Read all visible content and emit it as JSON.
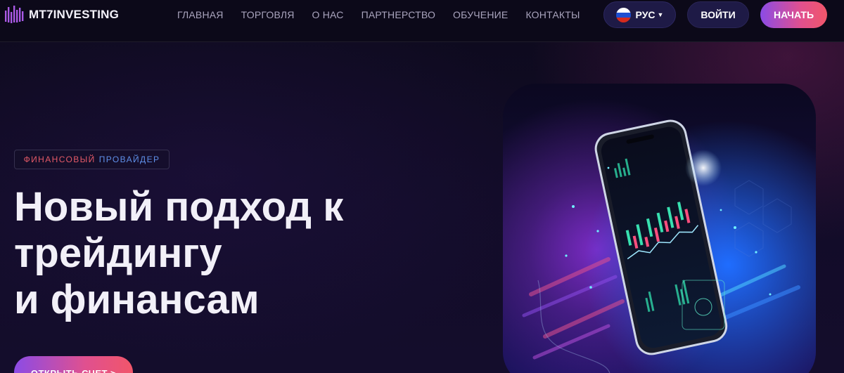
{
  "header": {
    "logo_text": "MT7INVESTING",
    "nav": [
      "ГЛАВНАЯ",
      "ТОРГОВЛЯ",
      "О НАС",
      "ПАРТНЕРСТВО",
      "ОБУЧЕНИЕ",
      "КОНТАКТЫ"
    ],
    "language": "РУС",
    "language_icon": "russia-flag-icon",
    "login_label": "ВОЙТИ",
    "start_label": "НАЧАТЬ"
  },
  "hero": {
    "badge_part1": "ФИНАНСОВЫЙ",
    "badge_part2": "ПРОВАЙДЕР",
    "title_lines": [
      "Новый подход к",
      "трейдингу",
      "и финансам"
    ],
    "cta_label": "ОТКРЫТЬ СЧЕТ >"
  },
  "colors": {
    "accent_gradient_start": "#8b4be6",
    "accent_gradient_end": "#f1566a",
    "badge_red": "#e35a67",
    "badge_blue": "#5f8fe8",
    "background": "#0f0b1f"
  }
}
